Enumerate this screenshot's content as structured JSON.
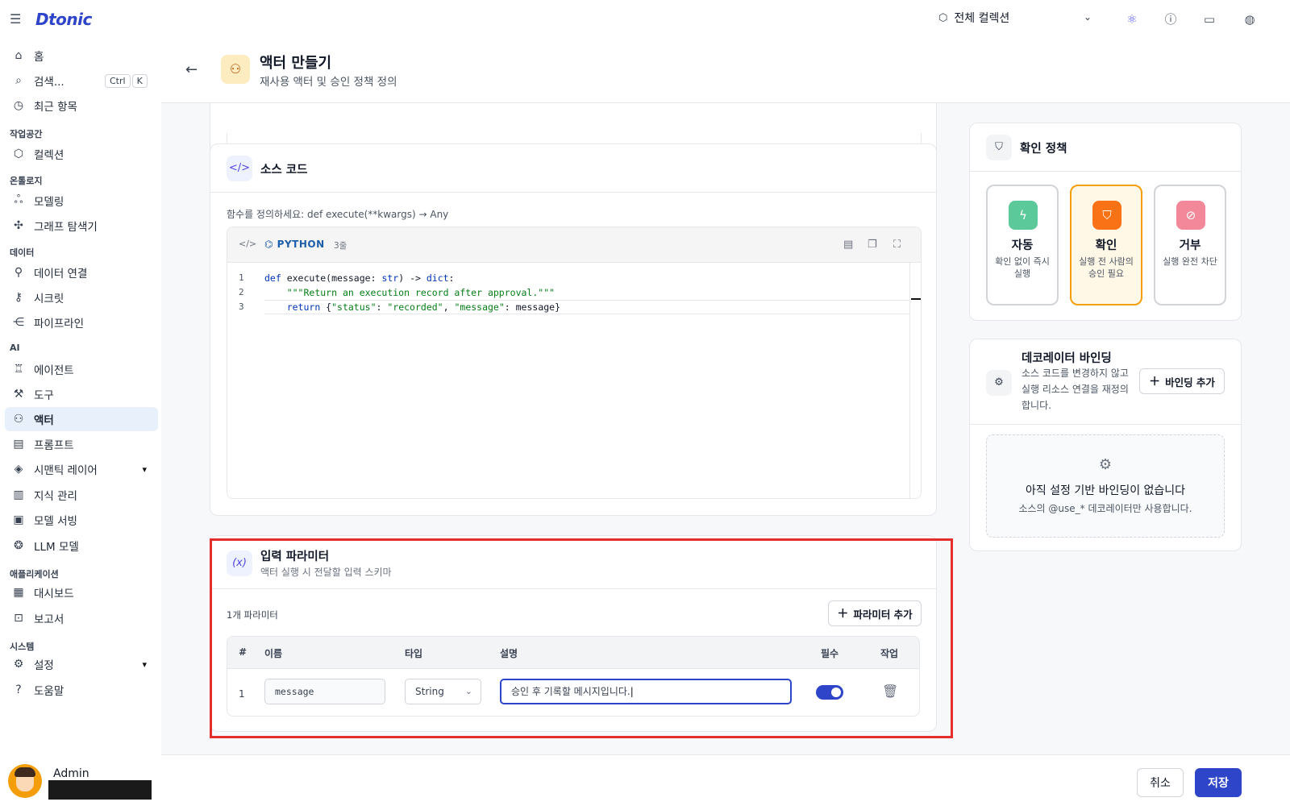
{
  "app": {
    "logo": "Dtonic"
  },
  "topbar": {
    "collection_label": "전체 컬렉션",
    "icons": [
      "menu-icon",
      "cube-icon",
      "chevron-down-icon",
      "atom-icon",
      "info-icon",
      "monitor-icon",
      "globe-icon"
    ]
  },
  "sidebar": {
    "home": "홈",
    "search": "검색...",
    "search_kbd": [
      "Ctrl",
      "K"
    ],
    "recent": "최근 항목",
    "sections": {
      "workspace": "작업공간",
      "ontology": "온톨로지",
      "data": "데이터",
      "ai": "AI",
      "apps": "애플리케이션",
      "system": "시스템"
    },
    "items": {
      "collection": "컬렉션",
      "modeling": "모델링",
      "graph": "그래프 탐색기",
      "data_conn": "데이터 연결",
      "secret": "시크릿",
      "pipeline": "파이프라인",
      "agent": "에이전트",
      "tool": "도구",
      "actor": "액터",
      "prompt": "프롬프트",
      "semantic": "시맨틱 레이어",
      "knowledge": "지식 관리",
      "serving": "모델 서빙",
      "llm": "LLM 모델",
      "dashboard": "대시보드",
      "report": "보고서",
      "settings": "설정",
      "help": "도움말"
    },
    "user": {
      "name": "Admin"
    }
  },
  "header": {
    "title": "액터 만들기",
    "subtitle": "재사용 액터 및 승인 정책 정의"
  },
  "source": {
    "title": "소스 코드",
    "hint": "함수를 정의하세요: def execute(**kwargs) → Any",
    "language": "PYTHON",
    "line_count": "3줄",
    "lines": [
      {
        "n": "1",
        "parts": [
          [
            "kw",
            "def "
          ],
          [
            "fn",
            "execute"
          ],
          [
            "p",
            "("
          ],
          [
            "fn",
            "message"
          ],
          [
            "p",
            ": "
          ],
          [
            "blt",
            "str"
          ],
          [
            "p",
            ") -> "
          ],
          [
            "blt",
            "dict"
          ],
          [
            "p",
            ":"
          ]
        ]
      },
      {
        "n": "2",
        "parts": [
          [
            "p",
            "    "
          ],
          [
            "str",
            "\"\"\"Return an execution record after approval.\"\"\""
          ]
        ]
      },
      {
        "n": "3",
        "parts": [
          [
            "p",
            "    "
          ],
          [
            "kw",
            "return "
          ],
          [
            "p",
            "{"
          ],
          [
            "str",
            "\"status\""
          ],
          [
            "p",
            ": "
          ],
          [
            "str",
            "\"recorded\""
          ],
          [
            "p",
            ", "
          ],
          [
            "str",
            "\"message\""
          ],
          [
            "p",
            ": message}"
          ]
        ]
      }
    ]
  },
  "params": {
    "title": "입력 파라미터",
    "subtitle": "액터 실행 시 전달할 입력 스키마",
    "count": "1개 파라미터",
    "add_label": "파라미터 추가",
    "columns": {
      "num": "#",
      "name": "이름",
      "type": "타입",
      "desc": "설명",
      "required": "필수",
      "action": "작업"
    },
    "rows": [
      {
        "num": "1",
        "name": "message",
        "type": "String",
        "desc": "승인 후 기록할 메시지입니다.",
        "required": true
      }
    ]
  },
  "policy": {
    "title": "확인 정책",
    "options": [
      {
        "label": "자동",
        "desc": "확인 없이 즉시 실행",
        "color": "#5cc99a"
      },
      {
        "label": "확인",
        "desc": "실행 전 사람의 승인 필요",
        "color": "#f97316",
        "selected": true
      },
      {
        "label": "거부",
        "desc": "실행 완전 차단",
        "color": "#f3889a"
      }
    ]
  },
  "binding": {
    "title": "데코레이터 바인딩",
    "desc": "소스 코드를 변경하지 않고 실행 리소스 연결을 재정의합니다.",
    "add_label": "바인딩 추가",
    "empty_title": "아직 설정 기반 바인딩이 없습니다",
    "empty_sub": "소스의 @use_* 데코레이터만 사용합니다."
  },
  "footer": {
    "cancel": "취소",
    "save": "저장"
  },
  "colors": {
    "accent": "#2f45c9",
    "highlight": "#e52d2d",
    "selected": "#f59e0b"
  }
}
